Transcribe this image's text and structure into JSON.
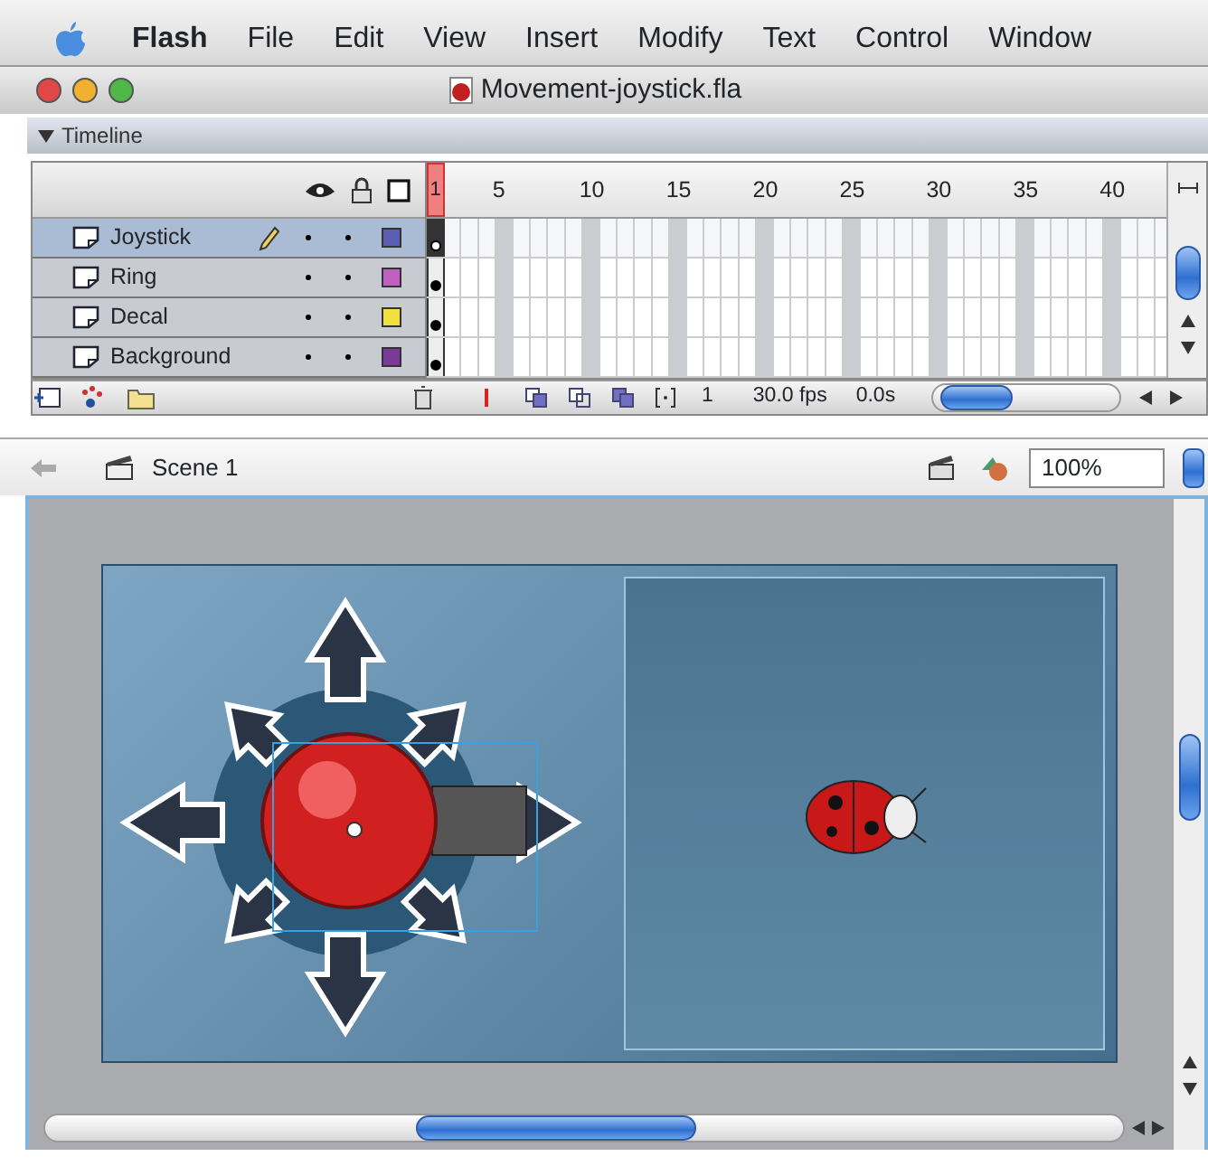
{
  "menu_bar": {
    "items": [
      "Flash",
      "File",
      "Edit",
      "View",
      "Insert",
      "Modify",
      "Text",
      "Control",
      "Window"
    ]
  },
  "window": {
    "title": "Movement-joystick.fla"
  },
  "timeline": {
    "title": "Timeline",
    "expanded": true,
    "frame_labels": [
      "1",
      "5",
      "10",
      "15",
      "20",
      "25",
      "30",
      "35",
      "40"
    ],
    "layers": [
      {
        "name": "Joystick",
        "selected": true,
        "editing": true,
        "color": "#5a5fb4"
      },
      {
        "name": "Ring",
        "selected": false,
        "editing": false,
        "color": "#c060c0"
      },
      {
        "name": "Decal",
        "selected": false,
        "editing": false,
        "color": "#f0e040"
      },
      {
        "name": "Background",
        "selected": false,
        "editing": false,
        "color": "#7a3a9a"
      }
    ],
    "current_frame": "1",
    "frame_rate": "30.0 fps",
    "elapsed_time": "0.0s"
  },
  "scene_bar": {
    "scene": "Scene 1",
    "zoom": "100%"
  }
}
